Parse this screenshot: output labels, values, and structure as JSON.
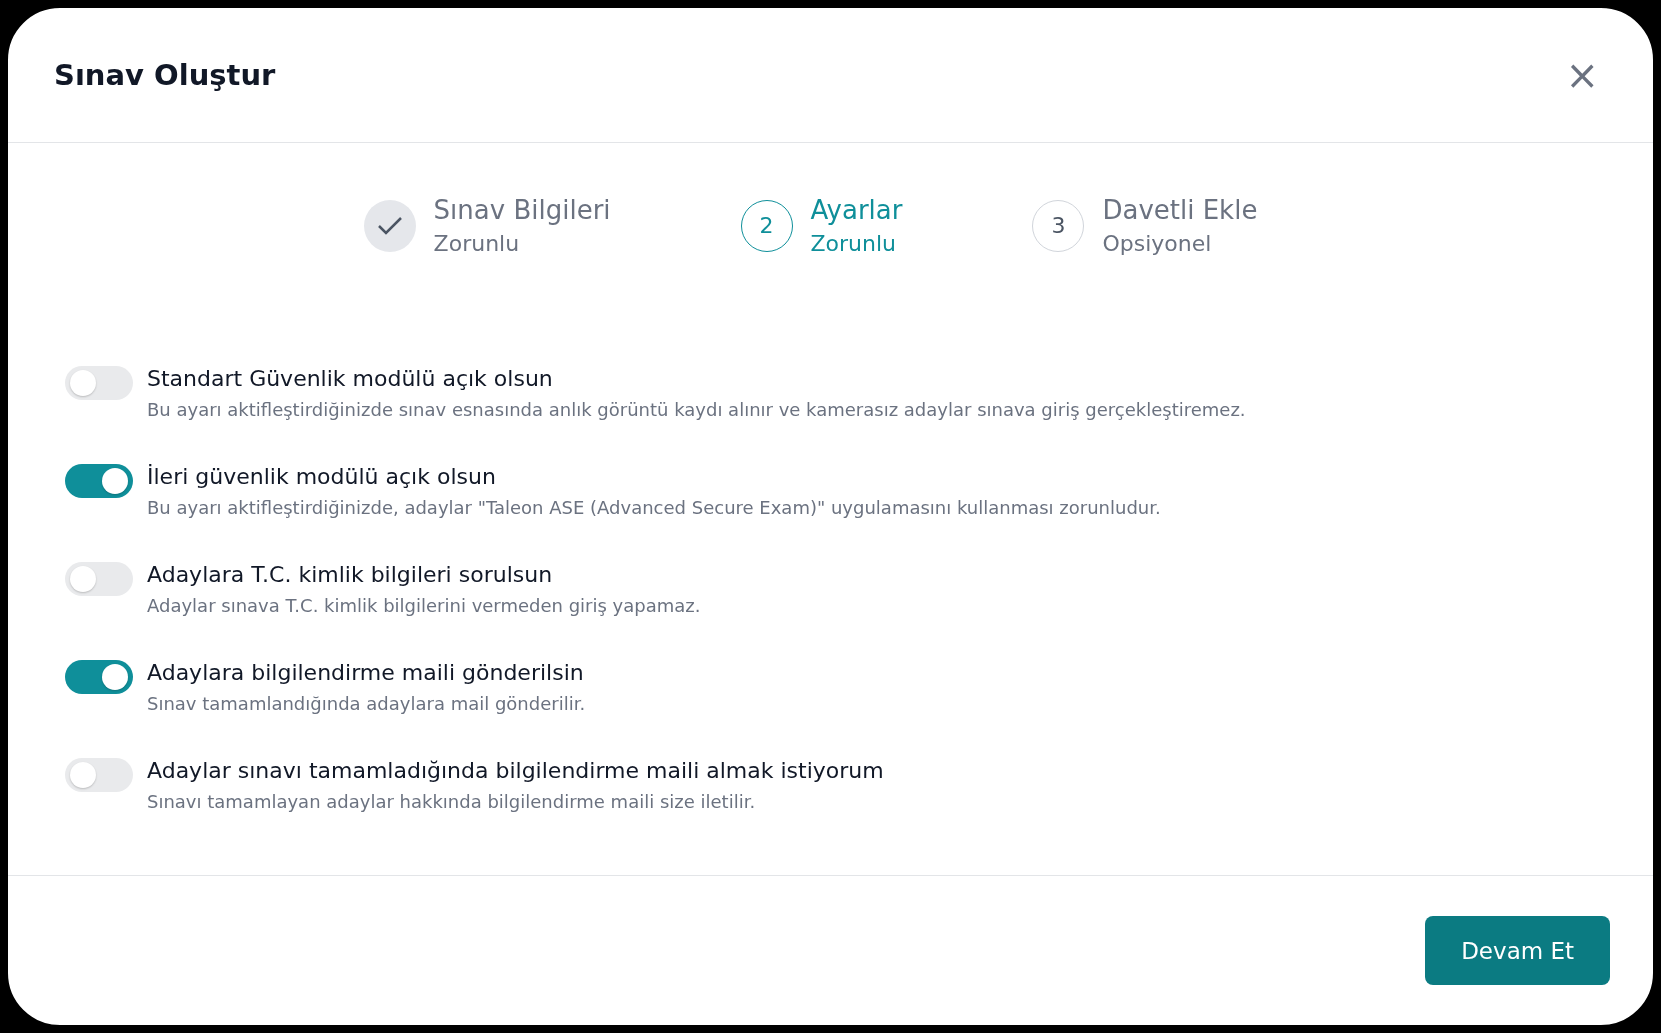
{
  "dialog": {
    "title": "Sınav Oluştur",
    "close": "×"
  },
  "steps": [
    {
      "kind": "done",
      "title": "Sınav Bilgileri",
      "subtitle": "Zorunlu",
      "selected": false
    },
    {
      "kind": "number",
      "number": "2",
      "title": "Ayarlar",
      "subtitle": "Zorunlu",
      "selected": true
    },
    {
      "kind": "number",
      "number": "3",
      "title": "Davetli Ekle",
      "subtitle": "Opsiyonel",
      "selected": false
    }
  ],
  "settings": [
    {
      "label": "Standart Güvenlik modülü açık olsun",
      "description": "Bu ayarı aktifleştirdiğinizde sınav esnasında anlık görüntü kaydı alınır ve kamerasız adaylar sınava giriş gerçekleştiremez.",
      "on": false
    },
    {
      "label": "İleri güvenlik modülü açık olsun",
      "description": "Bu ayarı aktifleştirdiğinizde, adaylar \"Taleon ASE (Advanced Secure Exam)\" uygulamasını kullanması zorunludur.",
      "on": true
    },
    {
      "label": "Adaylara T.C. kimlik bilgileri sorulsun",
      "description": "Adaylar sınava T.C. kimlik bilgilerini vermeden giriş yapamaz.",
      "on": false
    },
    {
      "label": "Adaylara bilgilendirme maili gönderilsin",
      "description": "Sınav tamamlandığında adaylara mail gönderilir.",
      "on": true
    },
    {
      "label": "Adaylar sınavı tamamladığında bilgilendirme maili almak istiyorum",
      "description": "Sınavı tamamlayan adaylar hakkında bilgilendirme maili size iletilir.",
      "on": false
    }
  ],
  "footer": {
    "button": "Devam Et"
  }
}
